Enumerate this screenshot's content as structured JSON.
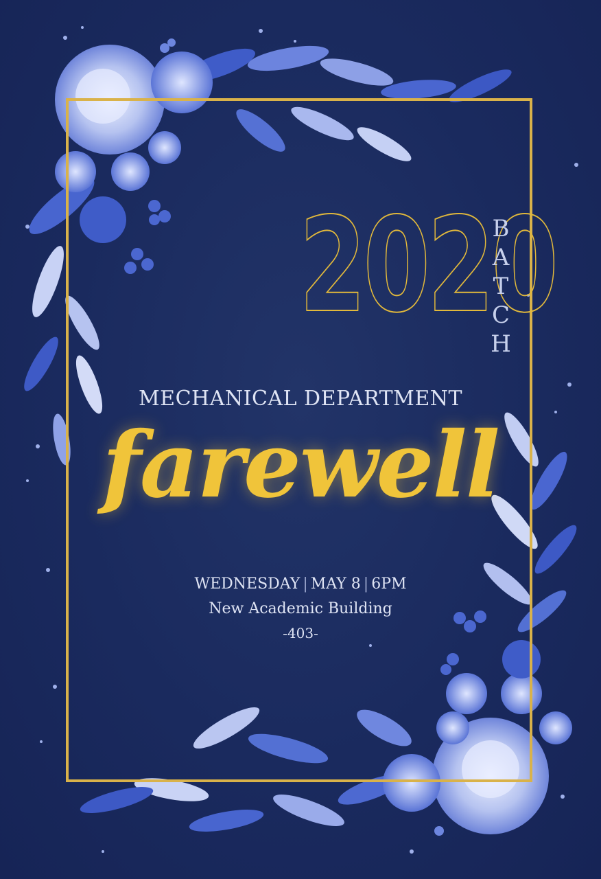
{
  "invitation": {
    "year": "2020",
    "batch_letters": [
      "B",
      "A",
      "T",
      "C",
      "H"
    ],
    "department": "MECHANICAL DEPARTMENT",
    "headline": "farewell",
    "day": "WEDNESDAY",
    "date": "MAY 8",
    "time": "6PM",
    "venue": "New Academic Building",
    "room": "-403-"
  },
  "colors": {
    "background": "#1b2a5c",
    "gold": "#d9b24a",
    "headline_gold": "#f0c43a",
    "text": "#dfe4f4",
    "flowers": "#4e6bd4"
  }
}
